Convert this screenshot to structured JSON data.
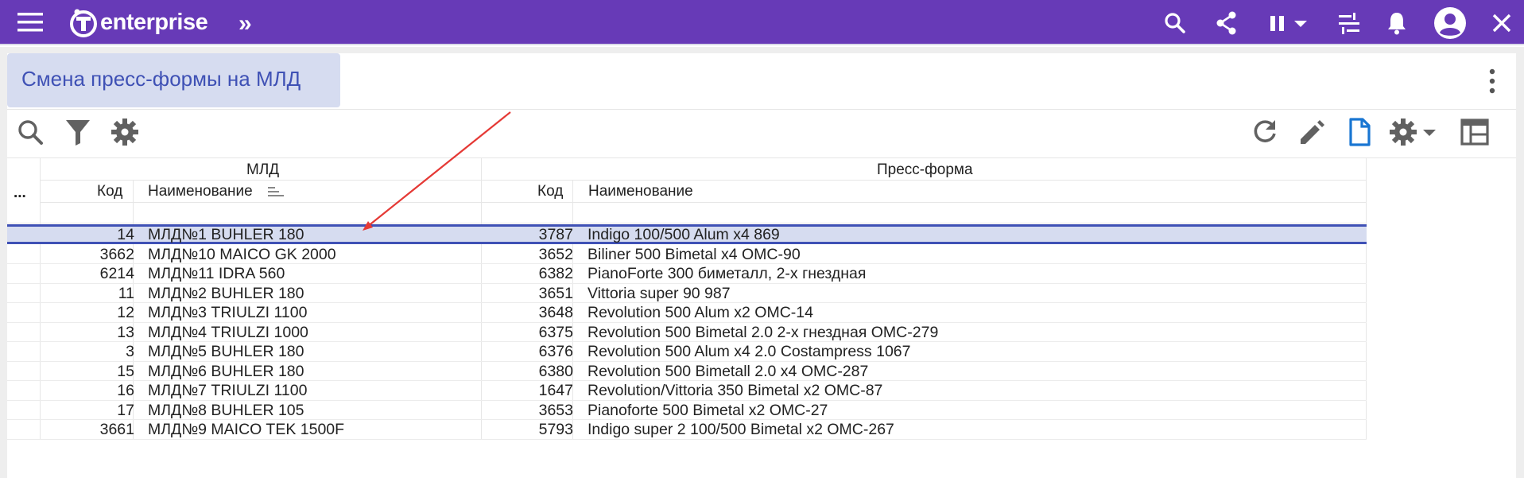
{
  "app": {
    "logo_text": "enterprise",
    "nav_chevron": "»",
    "icons": [
      "menu-icon",
      "search-icon",
      "share-icon",
      "pause-icon",
      "chevron-down-icon",
      "list-settings-icon",
      "bell-icon",
      "account-icon",
      "close-icon"
    ],
    "accent": "#673ab7"
  },
  "page": {
    "title": "Смена пресс-формы на МЛД",
    "title_color": "#3f51b5",
    "tab_bg": "#d6dcf0"
  },
  "toolbar": {
    "left_icons": [
      "search-icon",
      "filter-icon",
      "gear-icon"
    ],
    "right_icons": [
      "refresh-icon",
      "edit-icon",
      "document-icon",
      "gear-icon",
      "chevron-down-icon",
      "grid-layout-icon"
    ]
  },
  "table": {
    "more_label": "...",
    "groups": [
      "МЛД",
      "Пресс-форма"
    ],
    "columns": [
      "Код",
      "Наименование",
      "Код",
      "Наименование"
    ],
    "selected_index": 0,
    "rows": [
      [
        "14",
        "МЛД№1 BUHLER 180",
        "3787",
        "Indigo 100/500 Alum x4 869"
      ],
      [
        "3662",
        "МЛД№10 MAICO GK 2000",
        "3652",
        "Biliner 500 Bimetal x4 OMC-90"
      ],
      [
        "6214",
        "МЛД№11 IDRA 560",
        "6382",
        "PianoForte 300 биметалл, 2-х гнездная"
      ],
      [
        "11",
        "МЛД№2 BUHLER 180",
        "3651",
        "Vittoria super 90 987"
      ],
      [
        "12",
        "МЛД№3 TRIULZI 1100",
        "3648",
        "Revolution 500 Alum x2 OMC-14"
      ],
      [
        "13",
        "МЛД№4 TRIULZI 1000",
        "6375",
        "Revolution 500 Bimetal 2.0 2-х гнездная OMC-279"
      ],
      [
        "3",
        "МЛД№5 BUHLER 180",
        "6376",
        "Revolution 500 Alum x4 2.0 Costampress 1067"
      ],
      [
        "15",
        "МЛД№6 BUHLER 180",
        "6380",
        "Revolution 500 Bimetall 2.0 x4 OMC-287"
      ],
      [
        "16",
        "МЛД№7 TRIULZI 1100",
        "1647",
        "Revolution/Vittoria 350 Bimetal x2 OMC-87"
      ],
      [
        "17",
        "МЛД№8 BUHLER 105",
        "3653",
        "Pianoforte 500 Bimetal x2 OMC-27"
      ],
      [
        "3661",
        "МЛД№9 MAICO TEK 1500F",
        "5793",
        "Indigo super 2 100/500 Bimetal x2 OMC-267"
      ]
    ]
  }
}
